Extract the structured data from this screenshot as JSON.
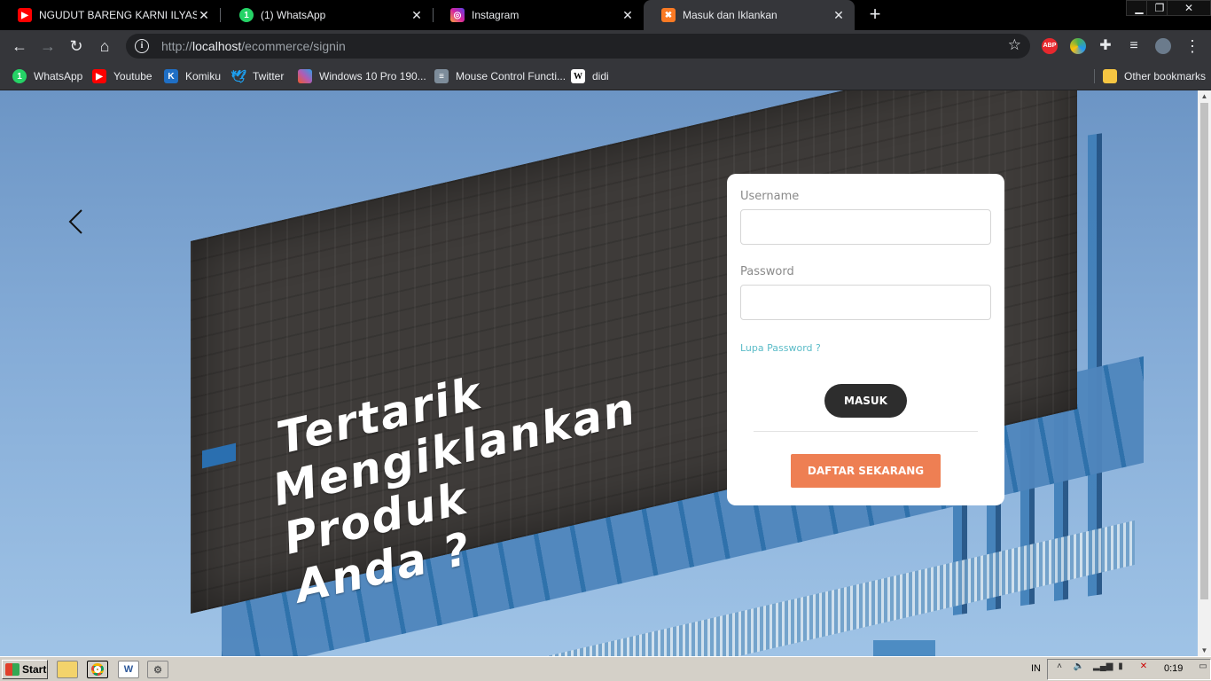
{
  "browser": {
    "tabs": [
      {
        "title": "NGUDUT BARENG KARNI ILYAS☐ (",
        "icon": "youtube-icon",
        "color": "#ff0000",
        "active": false
      },
      {
        "title": "(1) WhatsApp",
        "icon": "whatsapp-icon",
        "color": "#25d366",
        "active": false
      },
      {
        "title": "Instagram",
        "icon": "instagram-icon",
        "color": "#d6249f",
        "active": false
      },
      {
        "title": "Masuk dan Iklankan",
        "icon": "xampp-icon",
        "color": "#fb7a24",
        "active": true
      }
    ],
    "address": {
      "scheme": "http://",
      "host": "localhost",
      "path": "/ecommerce/signin"
    },
    "extensions": [
      {
        "name": "adblock-plus-icon",
        "label": "ABP",
        "color": "#e7282e"
      },
      {
        "name": "google-earth-icon",
        "label": "",
        "color": "#4caf50"
      }
    ],
    "bookmarks": [
      {
        "label": "WhatsApp",
        "icon": "whatsapp-icon",
        "color": "#25d366",
        "glyph": "1"
      },
      {
        "label": "Youtube",
        "icon": "youtube-icon",
        "color": "#ff0000",
        "glyph": "▶"
      },
      {
        "label": "Komiku",
        "icon": "komiku-icon",
        "color": "#1f6fc5",
        "glyph": "K"
      },
      {
        "label": "Twitter",
        "icon": "twitter-icon",
        "color": "#1da1f2",
        "glyph": "♥"
      },
      {
        "label": "Windows 10 Pro 190...",
        "icon": "windows-icon",
        "color": "#b05cb5",
        "glyph": "❖"
      },
      {
        "label": "Mouse Control Functi...",
        "icon": "document-icon",
        "color": "#7d8c9a",
        "glyph": "≡"
      },
      {
        "label": "didi",
        "icon": "wikipedia-icon",
        "color": "#ffffff",
        "glyph": "W"
      }
    ],
    "other_bookmarks": "Other bookmarks"
  },
  "page": {
    "headline": [
      "Tertarik",
      "Mengiklankan",
      "Produk",
      "Anda ?"
    ],
    "form": {
      "username_label": "Username",
      "username_value": "",
      "password_label": "Password",
      "password_value": "",
      "forgot": "Lupa Password ?",
      "login_button": "MASUK",
      "register_button": "DAFTAR SEKARANG"
    },
    "colors": {
      "login_button": "#2d2d2d",
      "register_button": "#ee7f53",
      "forgot_link": "#5bbcc8"
    }
  },
  "taskbar": {
    "start": "Start",
    "language": "IN",
    "clock": "0:19"
  }
}
